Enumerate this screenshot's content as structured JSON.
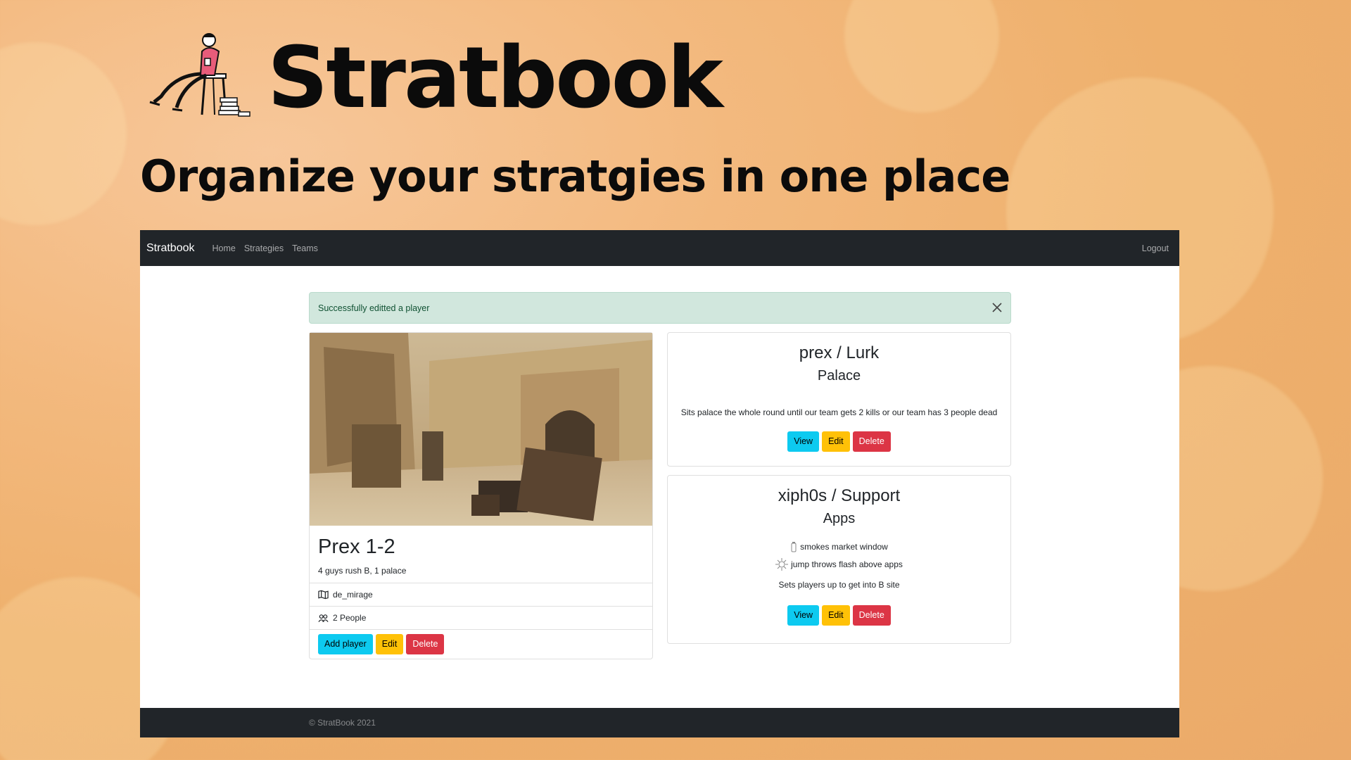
{
  "hero": {
    "brand": "Stratbook",
    "tagline": "Organize your stratgies in one place"
  },
  "navbar": {
    "brand": "Stratbook",
    "links": [
      "Home",
      "Strategies",
      "Teams"
    ],
    "logout": "Logout"
  },
  "alert": {
    "message": "Successfully editted a player",
    "close_icon": "close-icon"
  },
  "strategy": {
    "title": "Prex 1-2",
    "description": "4 guys rush B, 1 palace",
    "map": "de_mirage",
    "people": "2 People",
    "buttons": {
      "add_player": "Add player",
      "edit": "Edit",
      "delete": "Delete"
    }
  },
  "players": [
    {
      "title": "prex / Lurk",
      "position": "Palace",
      "utilities": [],
      "description": "Sits palace the whole round until our team gets 2 kills or our team has 3 people dead",
      "buttons": {
        "view": "View",
        "edit": "Edit",
        "delete": "Delete"
      }
    },
    {
      "title": "xiph0s / Support",
      "position": "Apps",
      "utilities": [
        {
          "icon": "smoke-grenade-icon",
          "text": "smokes market window"
        },
        {
          "icon": "flashbang-icon",
          "text": "jump throws flash above apps"
        }
      ],
      "description": "Sets players up to get into B site",
      "buttons": {
        "view": "View",
        "edit": "Edit",
        "delete": "Delete"
      }
    }
  ],
  "footer": {
    "copyright": "© StratBook 2021"
  },
  "colors": {
    "navbar_bg": "#212529",
    "alert_bg": "#d1e7dd",
    "btn_info": "#0dcaf0",
    "btn_warning": "#ffc107",
    "btn_danger": "#dc3545"
  }
}
